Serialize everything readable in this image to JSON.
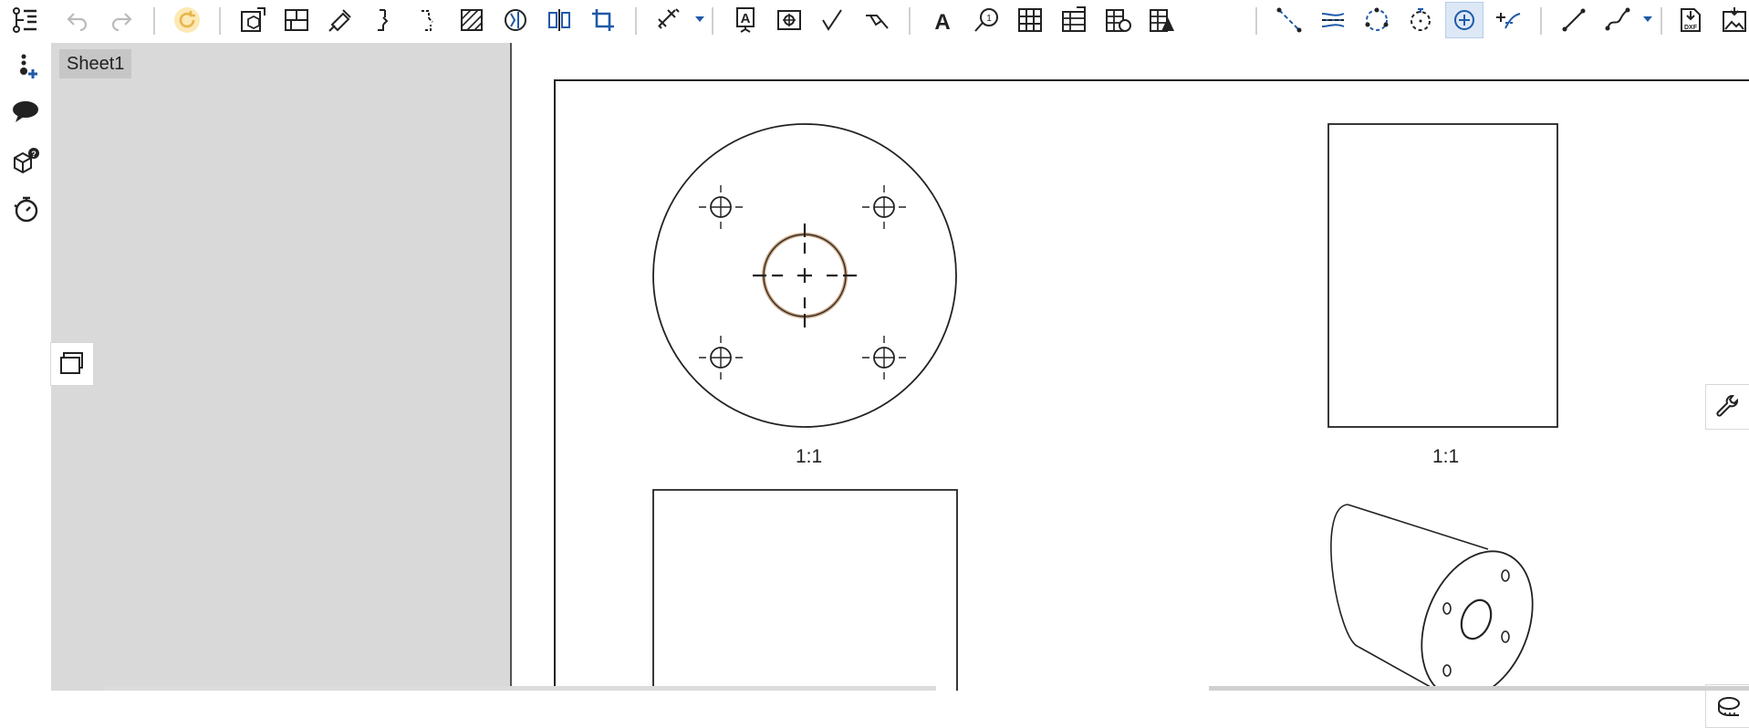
{
  "toolbar": {
    "tools": [
      {
        "name": "undo-icon",
        "label": "Undo"
      },
      {
        "name": "redo-icon",
        "label": "Redo"
      },
      {
        "name": "update-icon",
        "label": "Update"
      },
      {
        "name": "insert-view-icon",
        "label": "Insert view"
      },
      {
        "name": "section-view-icon",
        "label": "Section view"
      },
      {
        "name": "auxiliary-view-icon",
        "label": "Auxiliary view"
      },
      {
        "name": "break-view-icon",
        "label": "Break view"
      },
      {
        "name": "detail-view-icon",
        "label": "Detail view"
      },
      {
        "name": "hatch-icon",
        "label": "Hatch"
      },
      {
        "name": "broken-out-section-icon",
        "label": "Broken-out section"
      },
      {
        "name": "alignment-icon",
        "label": "Alignment"
      },
      {
        "name": "crop-view-icon",
        "label": "Crop view"
      },
      {
        "name": "dimension-icon",
        "label": "Dimension"
      },
      {
        "name": "note-icon",
        "label": "Note"
      },
      {
        "name": "datum-icon",
        "label": "Datum"
      },
      {
        "name": "surface-finish-icon",
        "label": "Surface finish"
      },
      {
        "name": "weld-icon",
        "label": "Weld"
      },
      {
        "name": "text-icon",
        "label": "Text"
      },
      {
        "name": "callout-icon",
        "label": "Callout"
      },
      {
        "name": "table-icon",
        "label": "Table"
      },
      {
        "name": "bom-icon",
        "label": "BOM"
      },
      {
        "name": "hole-table-icon",
        "label": "Hole table"
      },
      {
        "name": "revision-table-icon",
        "label": "Revision table"
      },
      {
        "name": "centerline-icon",
        "label": "Centerline"
      },
      {
        "name": "midpoint-line-icon",
        "label": "Midpoint centerline"
      },
      {
        "name": "bolt-circle-icon",
        "label": "Bolt circle"
      },
      {
        "name": "point-centerline-icon",
        "label": "Point centerline"
      },
      {
        "name": "centermark-icon",
        "label": "Centermark"
      },
      {
        "name": "tangent-edge-icon",
        "label": "Tangent edge"
      },
      {
        "name": "line-icon",
        "label": "Line"
      },
      {
        "name": "spline-icon",
        "label": "Spline"
      },
      {
        "name": "dxf-export-icon",
        "label": "DXF"
      },
      {
        "name": "image-export-icon",
        "label": "Image"
      }
    ],
    "active_tool": "centermark-icon",
    "accent_color": "#1e5aa8"
  },
  "left_rail": {
    "items": [
      {
        "name": "feature-list-icon"
      },
      {
        "name": "add-point-icon"
      },
      {
        "name": "comments-icon"
      },
      {
        "name": "part-info-icon"
      },
      {
        "name": "history-icon"
      }
    ]
  },
  "sheets": {
    "items": [
      {
        "label": "Sheet1"
      }
    ]
  },
  "drawing": {
    "views": [
      {
        "name": "front-view",
        "scale": "1:1"
      },
      {
        "name": "side-view",
        "scale": "1:1"
      },
      {
        "name": "top-view"
      },
      {
        "name": "isometric-view"
      }
    ],
    "selection_color": "#c8a27e"
  },
  "right_panel": {
    "tool_icon": "wrench-icon",
    "measure_icon": "measure-icon"
  }
}
